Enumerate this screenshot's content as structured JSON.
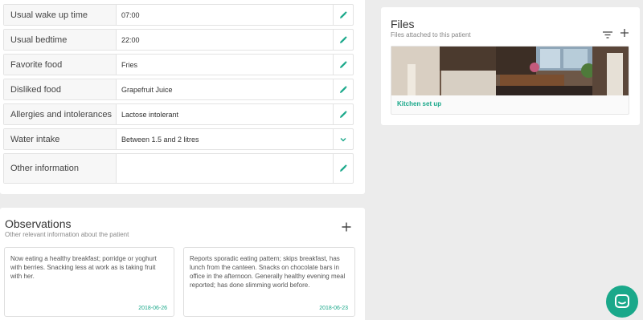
{
  "patient_fields": [
    {
      "label": "Usual wake up time",
      "value": "07:00",
      "action": "pencil-icon"
    },
    {
      "label": "Usual bedtime",
      "value": "22:00",
      "action": "pencil-icon"
    },
    {
      "label": "Favorite food",
      "value": "Fries",
      "action": "pencil-icon"
    },
    {
      "label": "Disliked food",
      "value": "Grapefruit Juice",
      "action": "pencil-icon"
    },
    {
      "label": "Allergies and intolerances",
      "value": "Lactose intolerant",
      "action": "pencil-icon"
    },
    {
      "label": "Water intake",
      "value": "Between 1.5 and 2 litres",
      "action": "chevron-down-icon"
    },
    {
      "label": "Other information",
      "value": "",
      "action": "pencil-icon"
    }
  ],
  "observations": {
    "title": "Observations",
    "subtitle": "Other relevant information about the patient",
    "cards": [
      {
        "text": "Now eating a healthy breakfast; porridge or yoghurt with berries. Snacking less at work as is taking fruit with her.",
        "date": "2018-06-26"
      },
      {
        "text": "Reports sporadic eating pattern; skips breakfast, has lunch from the canteen. Snacks on chocolate bars in office in the afternoon. Generally healthy evening meal reported; has done slimming world before.",
        "date": "2018-06-23"
      }
    ]
  },
  "files": {
    "title": "Files",
    "subtitle": "Files attached to this patient",
    "items": [
      {
        "name": "Kitchen set up"
      }
    ]
  },
  "colors": {
    "accent": "#1aa88a",
    "background": "#ececec"
  }
}
